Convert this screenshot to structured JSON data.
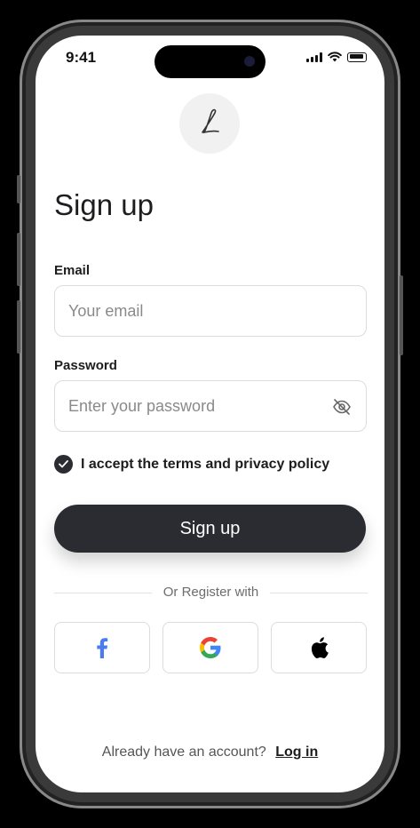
{
  "status_bar": {
    "time": "9:41"
  },
  "page": {
    "title": "Sign up"
  },
  "form": {
    "email_label": "Email",
    "email_placeholder": "Your email",
    "email_value": "",
    "password_label": "Password",
    "password_placeholder": "Enter your password",
    "password_value": "",
    "terms_text": "I accept the terms and privacy policy",
    "terms_checked": true,
    "submit_label": "Sign up"
  },
  "social": {
    "divider_text": "Or Register with",
    "buttons": [
      {
        "name": "facebook",
        "icon": "facebook-icon"
      },
      {
        "name": "google",
        "icon": "google-icon"
      },
      {
        "name": "apple",
        "icon": "apple-icon"
      }
    ]
  },
  "footer": {
    "prompt": "Already have an account?",
    "link_label": "Log in"
  },
  "colors": {
    "primary": "#2b2c31",
    "border": "#dcdcdc",
    "facebook": "#4a7cf0",
    "background": "#ffffff"
  }
}
